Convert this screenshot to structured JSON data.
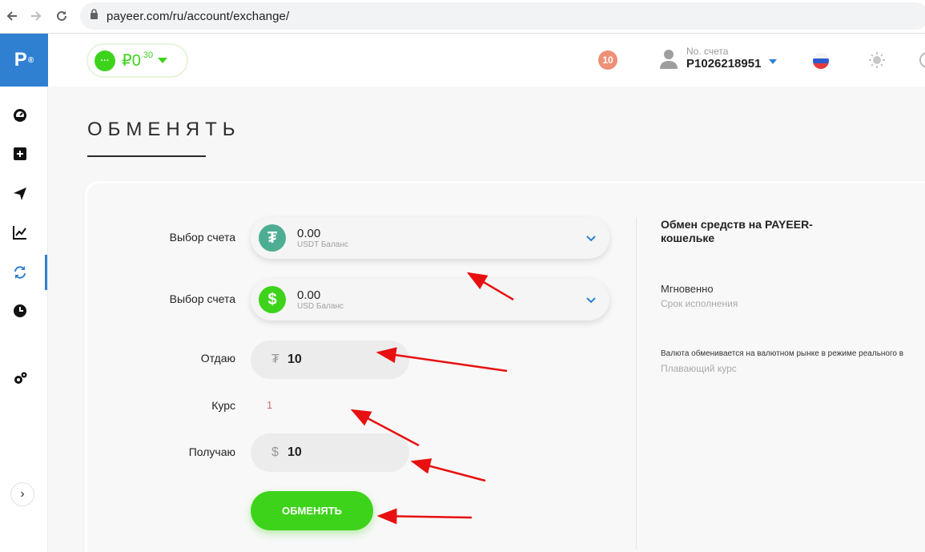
{
  "browser": {
    "url": "payeer.com/ru/account/exchange/"
  },
  "sidebar": {
    "logo_text": "P",
    "logo_mark": "®",
    "items": [
      {
        "name": "dashboard",
        "icon": "gauge-icon"
      },
      {
        "name": "add-funds",
        "icon": "plus-square-icon"
      },
      {
        "name": "send",
        "icon": "paper-plane-icon"
      },
      {
        "name": "trade",
        "icon": "chart-icon"
      },
      {
        "name": "exchange",
        "icon": "exchange-icon",
        "active": true
      },
      {
        "name": "history",
        "icon": "clock-icon"
      },
      {
        "name": "settings",
        "icon": "gears-icon"
      }
    ],
    "collapse_label": "›"
  },
  "header": {
    "balance_dot": "···",
    "balance_currency": "₽",
    "balance_main": "0",
    "balance_fraction": ".30",
    "notifications_count": "10",
    "account_caption": "No. счета",
    "account_number": "P1026218951",
    "accent_color": "#3ed31b",
    "brand_color": "#2f80d1"
  },
  "page": {
    "title": "ОБМЕНЯТЬ"
  },
  "form": {
    "from_label": "Выбор счета",
    "from_amount": "0.00",
    "from_caption": "USDT Баланс",
    "from_coin_symbol": "₮",
    "to_label": "Выбор счета",
    "to_amount": "0.00",
    "to_caption": "USD Баланс",
    "to_coin_symbol": "$",
    "give_label": "Отдаю",
    "give_currency": "₮",
    "give_value": "10",
    "rate_label": "Курс",
    "rate_value": "1",
    "receive_label": "Получаю",
    "receive_currency": "$",
    "receive_value": "10",
    "submit_label": "ОБМЕНЯТЬ"
  },
  "info": {
    "title": "Обмен средств на PAYEER-кошельке",
    "speed_value": "Мгновенно",
    "speed_caption": "Срок исполнения",
    "rate_note": "Валюта обменивается на валютном рынке в режиме реального в",
    "rate_caption": "Плавающий курс"
  }
}
